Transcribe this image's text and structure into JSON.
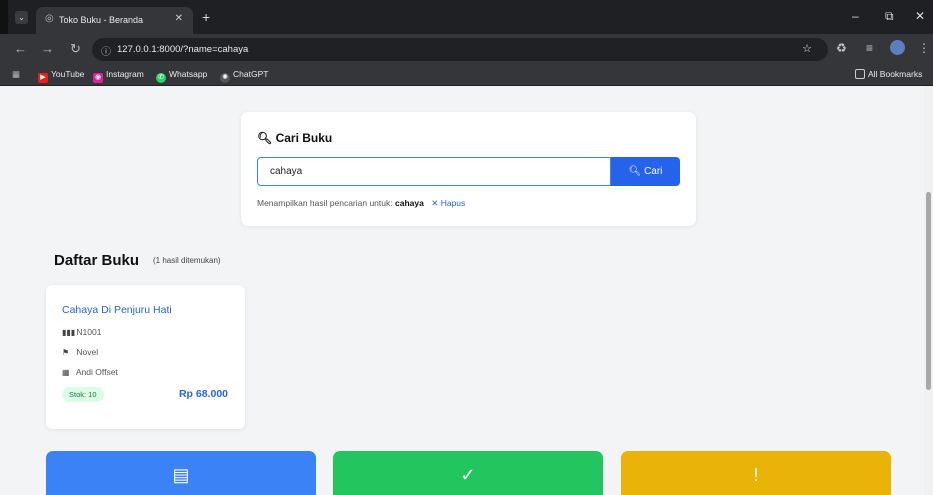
{
  "browser": {
    "tab_title": "Toko Buku - Beranda",
    "url": "127.0.0.1:8000/?name=cahaya",
    "bookmarks": [
      "YouTube",
      "Instagram",
      "Whatsapp",
      "ChatGPT"
    ],
    "all_bookmarks": "All Bookmarks"
  },
  "search": {
    "title": "Cari Buku",
    "value": "cahaya",
    "button_label": "Cari",
    "result_prefix": "Menampilkan hasil pencarian untuk:",
    "result_term": "cahaya",
    "clear_label": "Hapus"
  },
  "list": {
    "heading": "Daftar Buku",
    "count": "(1 hasil ditemukan)"
  },
  "books": [
    {
      "title": "Cahaya Di Penjuru Hati",
      "code": "N1001",
      "category": "Novel",
      "publisher": "Andi Offset",
      "stock": "Stok: 10",
      "price": "Rp 68.000"
    }
  ],
  "stat_colors": [
    "#3b82f6",
    "#22c55e",
    "#eab308"
  ]
}
